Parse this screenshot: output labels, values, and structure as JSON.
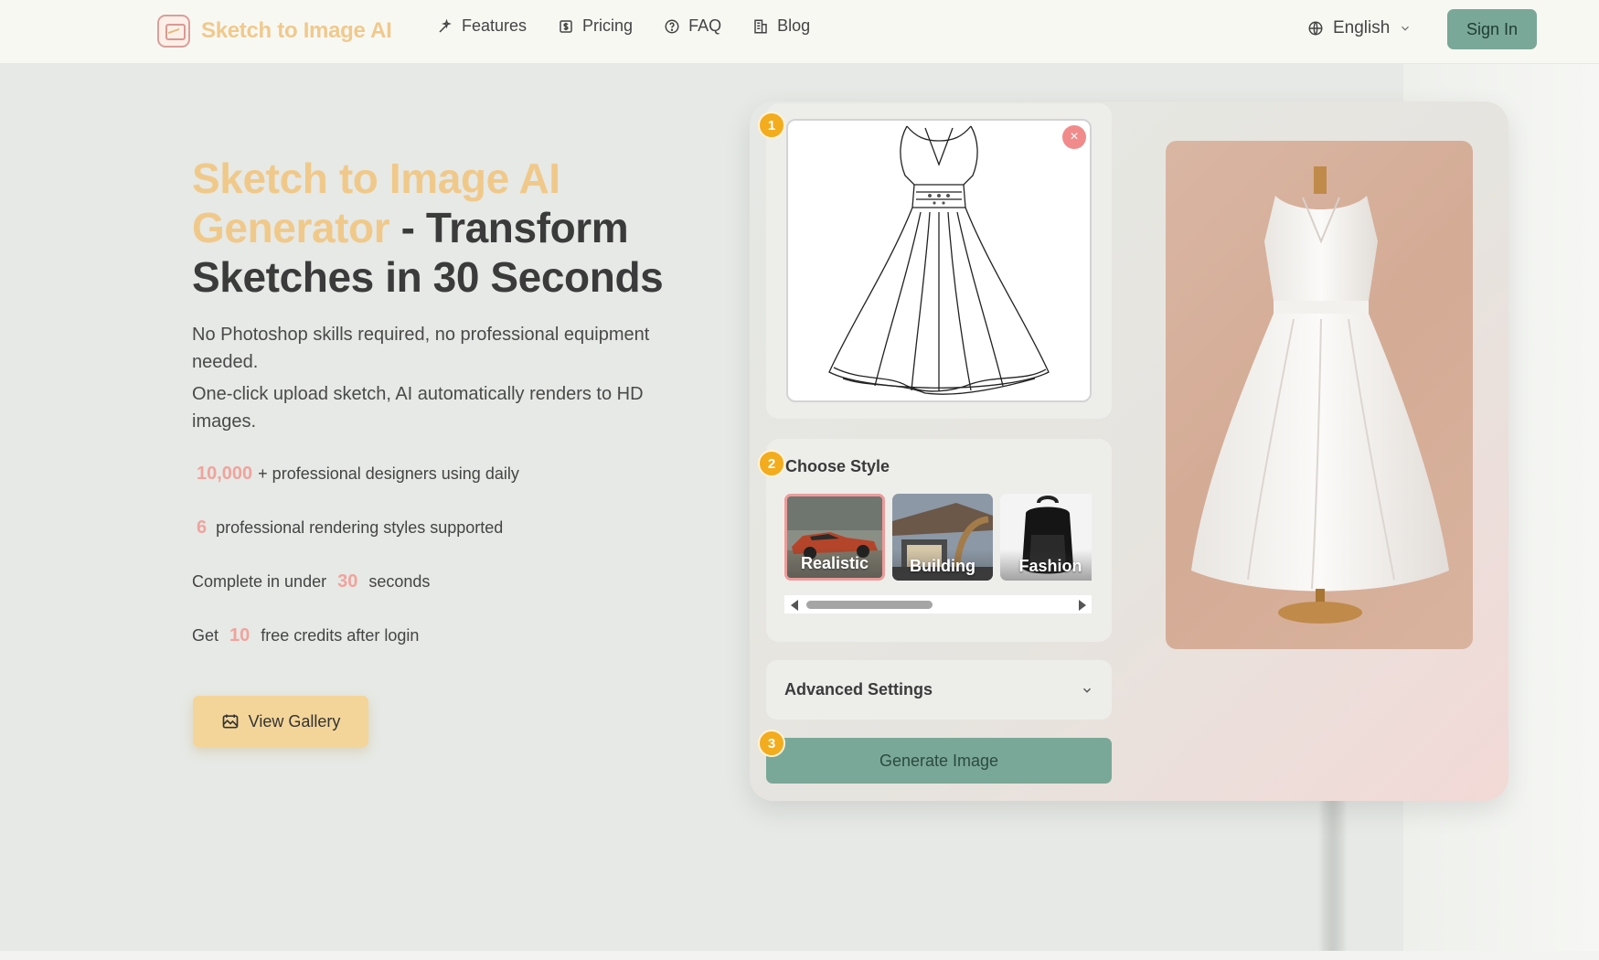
{
  "nav": {
    "brand": "Sketch to Image AI",
    "links": [
      {
        "label": "Features",
        "icon": "sparkle-icon"
      },
      {
        "label": "Pricing",
        "icon": "dollar-icon"
      },
      {
        "label": "FAQ",
        "icon": "question-icon"
      },
      {
        "label": "Blog",
        "icon": "building-icon"
      }
    ],
    "language": "English",
    "sign_in": "Sign In"
  },
  "hero": {
    "title_accent": "Sketch to Image AI Generator",
    "title_rest": " - Transform Sketches in 30 Seconds",
    "subtitle_1": "No Photoshop skills required, no professional equipment needed.",
    "subtitle_2": "One-click upload sketch, AI automatically renders to HD images.",
    "stats": [
      {
        "prefix": "",
        "number": "10,000",
        "suffix": "+ professional designers using daily"
      },
      {
        "prefix": "",
        "number": "6",
        "suffix": "professional rendering styles supported"
      },
      {
        "prefix": "Complete in under",
        "number": "30",
        "suffix": "seconds"
      },
      {
        "prefix": "Get",
        "number": "10",
        "suffix": "free credits after login"
      }
    ],
    "gallery_button": "View Gallery"
  },
  "generator": {
    "steps": [
      "1",
      "2",
      "3"
    ],
    "choose_style": "Choose Style",
    "styles": [
      {
        "label": "Realistic",
        "selected": true
      },
      {
        "label": "Building",
        "selected": false
      },
      {
        "label": "Fashion",
        "selected": false
      }
    ],
    "advanced_settings": "Advanced Settings",
    "generate_button": "Generate Image",
    "close_symbol": "×"
  },
  "colors": {
    "accent_yellow": "#f0c98a",
    "accent_pink": "#f0a39d",
    "primary_green": "#7aa898",
    "step_orange": "#f3ac1e"
  }
}
